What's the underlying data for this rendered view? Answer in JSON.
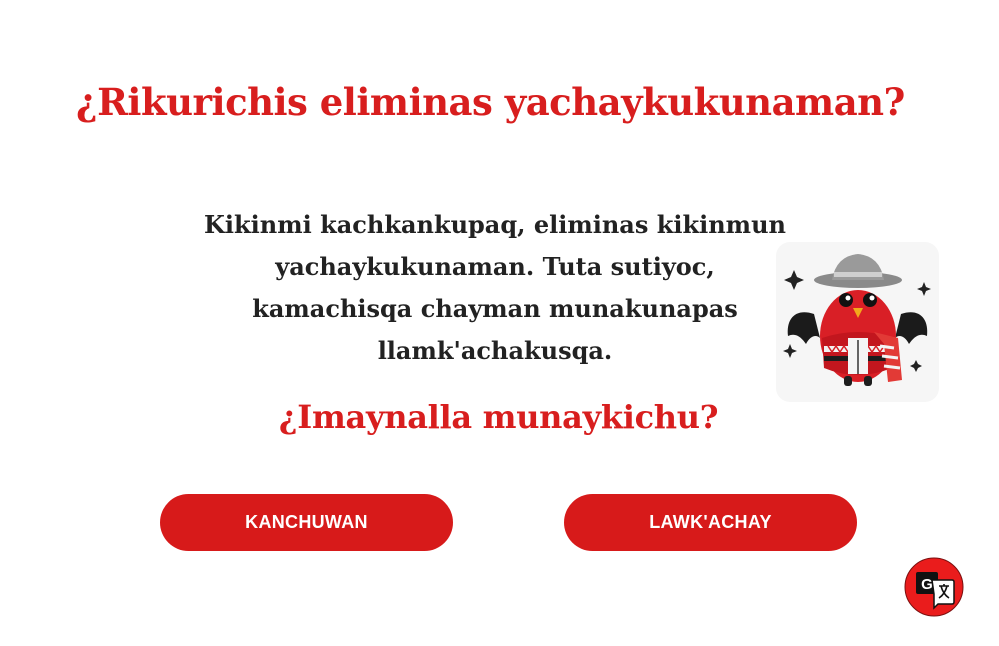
{
  "dialog": {
    "title": "¿Rikurichis eliminas yachaykukunaman?",
    "message_lines": [
      "Kikinmi kachkankupaq, eliminas kikinmun",
      "yachaykukunaman. Tuta sutiyoc,",
      "kamachisqa chayman munakunapas",
      "llamk'achakusqa."
    ],
    "question": "¿Imaynalla munaykichu?",
    "cancel_label": "KANCHUWAN",
    "confirm_label": "LAWK'ACHAY"
  },
  "mascot": {
    "icon": "bird-mascot-icon"
  },
  "translate_widget": {
    "icon": "google-translate-icon"
  },
  "colors": {
    "accent": "#d71a1a",
    "text": "#222222",
    "background": "#ffffff"
  }
}
